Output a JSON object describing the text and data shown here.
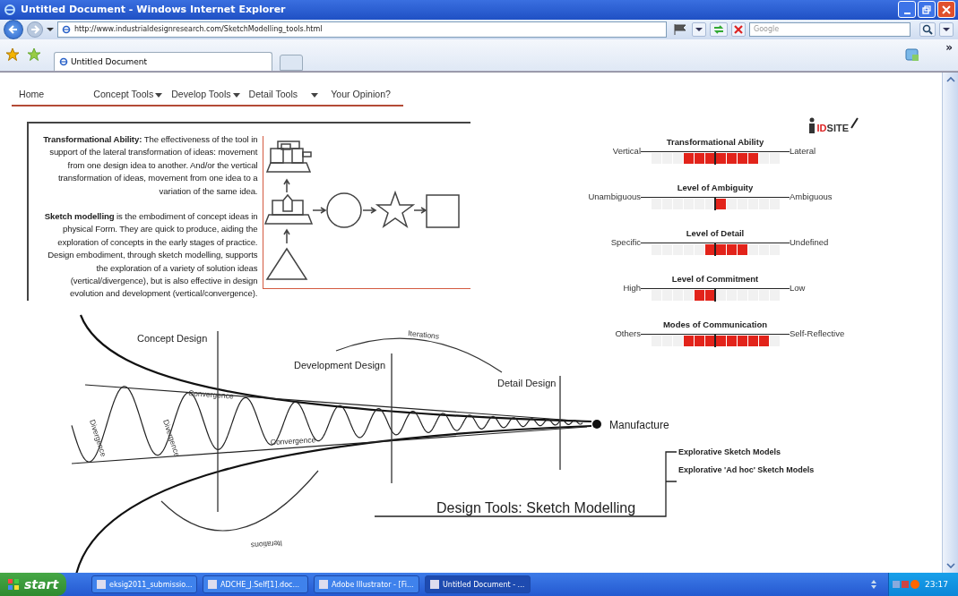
{
  "window": {
    "title": "Untitled Document - Windows Internet Explorer"
  },
  "toolbar": {
    "address": "http://www.industrialdesignresearch.com/SketchModelling_tools.html",
    "search_placeholder": "Google",
    "more": "»"
  },
  "tabs": [
    {
      "label": "Untitled Document",
      "selected": true
    }
  ],
  "nav": [
    {
      "label": "Home",
      "has_menu": false
    },
    {
      "label": "Concept Tools",
      "has_menu": true
    },
    {
      "label": "Develop Tools",
      "has_menu": true
    },
    {
      "label": "Detail Tools",
      "has_menu": true
    },
    {
      "label": "Your Opinion?",
      "has_menu": false
    }
  ],
  "description": [
    "**Transformational Ability:** The effectiveness of the tool in support of the lateral transformation of ideas: movement from one design idea to another. And/or the vertical transformation of ideas, movement from one idea to a variation of the same idea.",
    "**Sketch modelling** is the embodiment of concept ideas in physical Form. They are quick to produce, aiding the exploration of concepts in the early stages of practice. Design embodiment, through sketch modelling, supports the exploration of a variety of solution ideas (vertical/divergence), but is also effective in design evolution and development (vertical/convergence)."
  ],
  "logo": {
    "accent": "ID",
    "rest": "SITE"
  },
  "scales": [
    {
      "title": "Transformational Ability",
      "left": "Vertical",
      "right": "Lateral",
      "cells": [
        {
          "filled": false
        },
        {
          "filled": false
        },
        {
          "filled": false
        },
        {
          "filled": true
        },
        {
          "filled": true
        },
        {
          "filled": true
        },
        {
          "filled": true
        },
        {
          "filled": true
        },
        {
          "filled": true
        },
        {
          "filled": true
        },
        {
          "filled": false
        },
        {
          "filled": false
        }
      ]
    },
    {
      "title": "Level of Ambiguity",
      "left": "Unambiguous",
      "right": "Ambiguous",
      "cells": [
        {
          "filled": false
        },
        {
          "filled": false
        },
        {
          "filled": false
        },
        {
          "filled": false
        },
        {
          "filled": false
        },
        {
          "filled": false
        },
        {
          "filled": true
        },
        {
          "filled": false
        },
        {
          "filled": false
        },
        {
          "filled": false
        },
        {
          "filled": false
        },
        {
          "filled": false
        }
      ]
    },
    {
      "title": "Level of Detail",
      "left": "Specific",
      "right": "Undefined",
      "cells": [
        {
          "filled": false
        },
        {
          "filled": false
        },
        {
          "filled": false
        },
        {
          "filled": false
        },
        {
          "filled": false
        },
        {
          "filled": true
        },
        {
          "filled": true
        },
        {
          "filled": true
        },
        {
          "filled": true
        },
        {
          "filled": false
        },
        {
          "filled": false
        },
        {
          "filled": false
        }
      ]
    },
    {
      "title": "Level of Commitment",
      "left": "High",
      "right": "Low",
      "cells": [
        {
          "filled": false
        },
        {
          "filled": false
        },
        {
          "filled": false
        },
        {
          "filled": false
        },
        {
          "filled": true
        },
        {
          "filled": true
        },
        {
          "filled": false
        },
        {
          "filled": false
        },
        {
          "filled": false
        },
        {
          "filled": false
        },
        {
          "filled": false
        },
        {
          "filled": false
        }
      ]
    },
    {
      "title": "Modes  of Communication",
      "left": "Others",
      "right": "Self-Reflective",
      "cells": [
        {
          "filled": false
        },
        {
          "filled": false
        },
        {
          "filled": false
        },
        {
          "filled": true
        },
        {
          "filled": true
        },
        {
          "filled": true
        },
        {
          "filled": true
        },
        {
          "filled": true
        },
        {
          "filled": true
        },
        {
          "filled": true
        },
        {
          "filled": true
        },
        {
          "filled": false
        }
      ]
    }
  ],
  "diagram": {
    "phases": [
      "Concept Design",
      "Development Design",
      "Detail Design"
    ],
    "iterations": [
      "Iterations",
      "Iterations"
    ],
    "convergence": [
      "Convergence",
      "Convergence"
    ],
    "divergence": [
      "Divergence",
      "Divergence"
    ],
    "endpoint": "Manufacture",
    "title": "Design Tools: Sketch Modelling",
    "models": [
      "Explorative Sketch Models",
      "Explorative 'Ad hoc' Sketch Models"
    ]
  },
  "taskbar": {
    "start": "start",
    "tasks": [
      {
        "label": "eksig2011_submissio...",
        "selected": false
      },
      {
        "label": "ADCHE_J.Self[1].doc...",
        "selected": false
      },
      {
        "label": "Adobe Illustrator - [Fi...",
        "selected": false
      },
      {
        "label": "Untitled Document - ...",
        "selected": true
      }
    ],
    "clock": "23:17"
  }
}
